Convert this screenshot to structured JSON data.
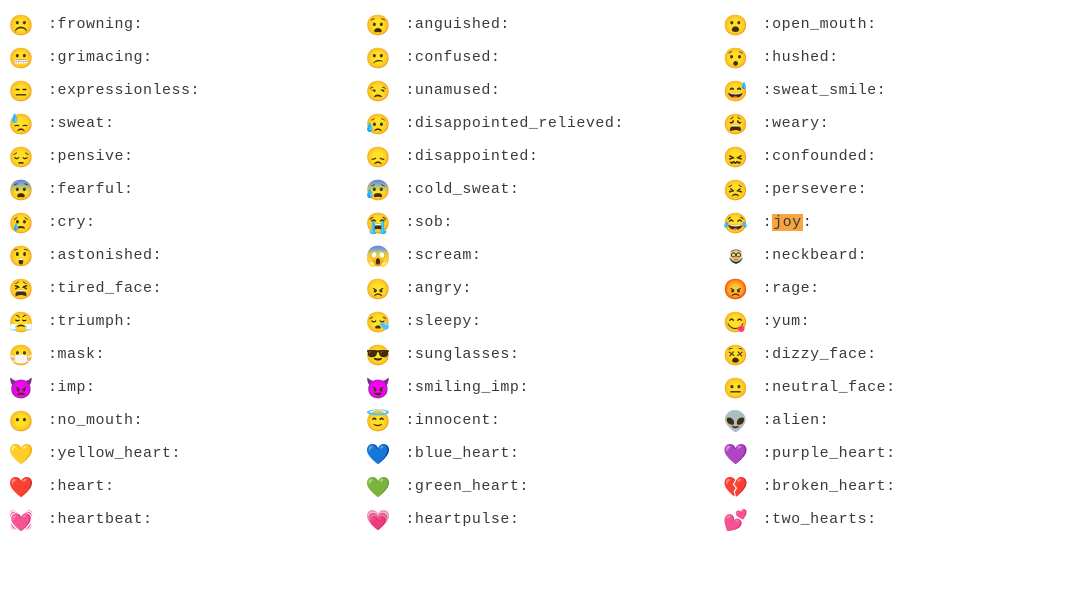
{
  "search_highlight": "joy",
  "rows": [
    [
      {
        "emoji": "☹️",
        "code": ":frowning:"
      },
      {
        "emoji": "😧",
        "code": ":anguished:"
      },
      {
        "emoji": "😮",
        "code": ":open_mouth:"
      }
    ],
    [
      {
        "emoji": "😬",
        "code": ":grimacing:"
      },
      {
        "emoji": "😕",
        "code": ":confused:"
      },
      {
        "emoji": "😯",
        "code": ":hushed:"
      }
    ],
    [
      {
        "emoji": "😑",
        "code": ":expressionless:"
      },
      {
        "emoji": "😒",
        "code": ":unamused:"
      },
      {
        "emoji": "😅",
        "code": ":sweat_smile:"
      }
    ],
    [
      {
        "emoji": "😓",
        "code": ":sweat:"
      },
      {
        "emoji": "😥",
        "code": ":disappointed_relieved:"
      },
      {
        "emoji": "😩",
        "code": ":weary:"
      }
    ],
    [
      {
        "emoji": "😔",
        "code": ":pensive:"
      },
      {
        "emoji": "😞",
        "code": ":disappointed:"
      },
      {
        "emoji": "😖",
        "code": ":confounded:"
      }
    ],
    [
      {
        "emoji": "😨",
        "code": ":fearful:"
      },
      {
        "emoji": "😰",
        "code": ":cold_sweat:"
      },
      {
        "emoji": "😣",
        "code": ":persevere:"
      }
    ],
    [
      {
        "emoji": "😢",
        "code": ":cry:"
      },
      {
        "emoji": "😭",
        "code": ":sob:"
      },
      {
        "emoji": "😂",
        "code": ":joy:",
        "highlight": true
      }
    ],
    [
      {
        "emoji": "😲",
        "code": ":astonished:"
      },
      {
        "emoji": "😱",
        "code": ":scream:"
      },
      {
        "emoji": "neckbeard",
        "code": ":neckbeard:",
        "is_neckbeard": true
      }
    ],
    [
      {
        "emoji": "😫",
        "code": ":tired_face:"
      },
      {
        "emoji": "😠",
        "code": ":angry:"
      },
      {
        "emoji": "😡",
        "code": ":rage:"
      }
    ],
    [
      {
        "emoji": "😤",
        "code": ":triumph:"
      },
      {
        "emoji": "😪",
        "code": ":sleepy:"
      },
      {
        "emoji": "😋",
        "code": ":yum:"
      }
    ],
    [
      {
        "emoji": "😷",
        "code": ":mask:"
      },
      {
        "emoji": "😎",
        "code": ":sunglasses:"
      },
      {
        "emoji": "😵",
        "code": ":dizzy_face:"
      }
    ],
    [
      {
        "emoji": "👿",
        "code": ":imp:"
      },
      {
        "emoji": "😈",
        "code": ":smiling_imp:"
      },
      {
        "emoji": "😐",
        "code": ":neutral_face:"
      }
    ],
    [
      {
        "emoji": "😶",
        "code": ":no_mouth:"
      },
      {
        "emoji": "😇",
        "code": ":innocent:"
      },
      {
        "emoji": "👽",
        "code": ":alien:"
      }
    ],
    [
      {
        "emoji": "💛",
        "code": ":yellow_heart:"
      },
      {
        "emoji": "💙",
        "code": ":blue_heart:"
      },
      {
        "emoji": "💜",
        "code": ":purple_heart:"
      }
    ],
    [
      {
        "emoji": "❤️",
        "code": ":heart:"
      },
      {
        "emoji": "💚",
        "code": ":green_heart:"
      },
      {
        "emoji": "💔",
        "code": ":broken_heart:"
      }
    ],
    [
      {
        "emoji": "💓",
        "code": ":heartbeat:"
      },
      {
        "emoji": "💗",
        "code": ":heartpulse:"
      },
      {
        "emoji": "💕",
        "code": ":two_hearts:"
      }
    ]
  ]
}
